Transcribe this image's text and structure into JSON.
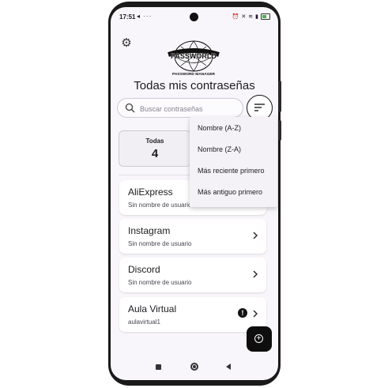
{
  "status_bar": {
    "time": "17:51",
    "left_icons": "◂ ···",
    "battery_color": "#4caf50"
  },
  "header": {
    "logo_text": "PASSWORLD",
    "logo_subtext": "PASSWORD MANAGER",
    "title": "Todas mis contraseñas"
  },
  "search": {
    "placeholder": "Buscar contraseñas",
    "value": ""
  },
  "stats": [
    {
      "label": "Todas",
      "count": "4"
    }
  ],
  "passwords": [
    {
      "name": "AliExpress",
      "user": "Sin nombre de usuario",
      "warning": false
    },
    {
      "name": "Instagram",
      "user": "Sin nombre de usuario",
      "warning": false
    },
    {
      "name": "Discord",
      "user": "Sin nombre de usuario",
      "warning": false
    },
    {
      "name": "Aula Virtual",
      "user": "aulavirtual1",
      "warning": true
    }
  ],
  "sort_menu": {
    "options": [
      "Nombre (A-Z)",
      "Nombre (Z-A)",
      "Más reciente primero",
      "Más antiguo primero"
    ]
  },
  "icons": {
    "settings": "gear-icon",
    "search": "search-icon",
    "filter": "sort-icon",
    "add": "add-icon",
    "warning": "warning-icon",
    "chevron": "chevron-right-icon"
  }
}
